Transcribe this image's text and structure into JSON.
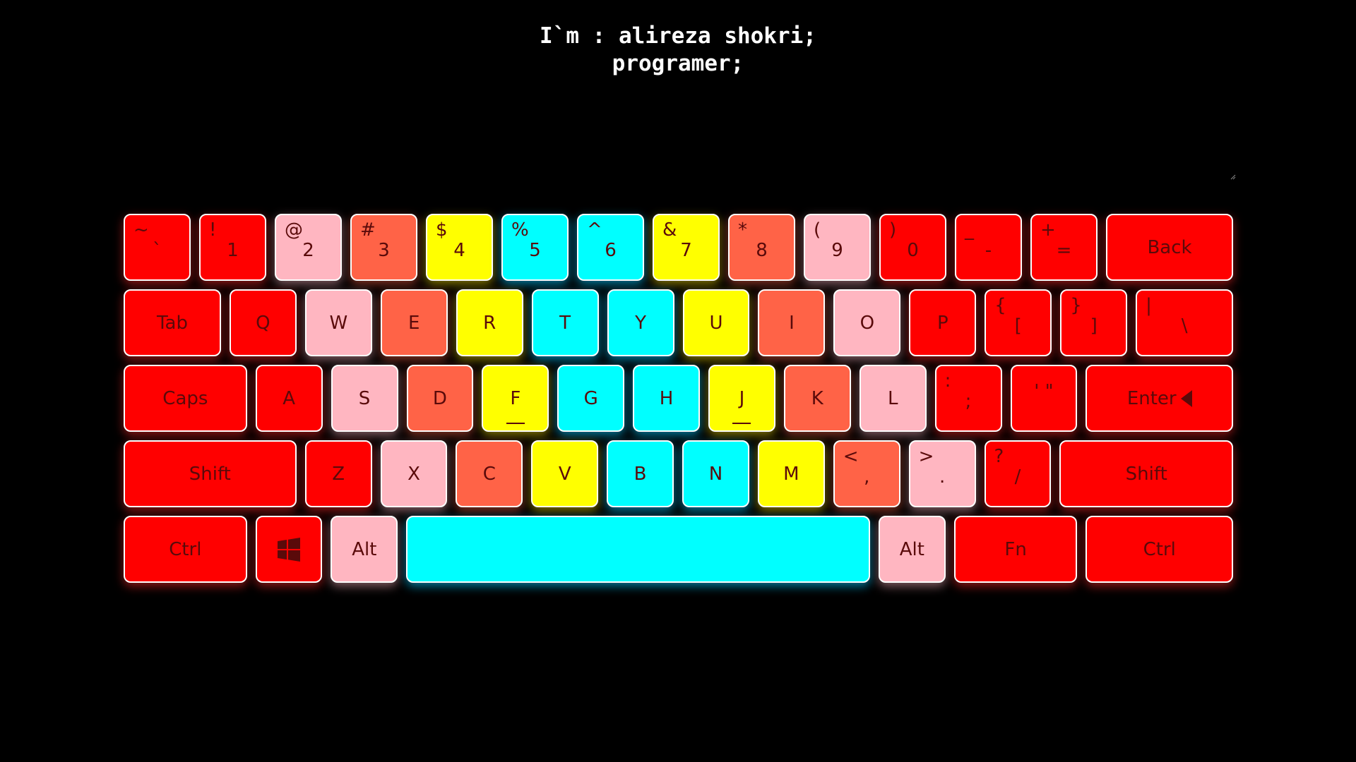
{
  "heading": {
    "line1": "I`m : alireza shokri;",
    "line2": "programer;"
  },
  "textarea": {
    "value": ""
  },
  "colors": {
    "background": "#000000",
    "red": "#ff0000",
    "pink": "#ffb6c1",
    "coral": "#ff6347",
    "yellow": "#ffff00",
    "cyan": "#00ffff"
  },
  "keyboard": {
    "row1": {
      "tilde": {
        "top": "~",
        "bottom": "`"
      },
      "k1": {
        "top": "!",
        "bottom": "1"
      },
      "k2": {
        "top": "@",
        "bottom": "2"
      },
      "k3": {
        "top": "#",
        "bottom": "3"
      },
      "k4": {
        "top": "$",
        "bottom": "4"
      },
      "k5": {
        "top": "%",
        "bottom": "5"
      },
      "k6": {
        "top": "^",
        "bottom": "6"
      },
      "k7": {
        "top": "&",
        "bottom": "7"
      },
      "k8": {
        "top": "*",
        "bottom": "8"
      },
      "k9": {
        "top": "(",
        "bottom": "9"
      },
      "k0": {
        "top": ")",
        "bottom": "0"
      },
      "minus": {
        "top": "_",
        "bottom": "-"
      },
      "equal": {
        "top": "+",
        "bottom": "="
      },
      "back": "Back"
    },
    "row2": {
      "tab": "Tab",
      "q": "Q",
      "w": "W",
      "e": "E",
      "r": "R",
      "t": "T",
      "y": "Y",
      "u": "U",
      "i": "I",
      "o": "O",
      "p": "P",
      "lbracket": {
        "top": "{",
        "bottom": "["
      },
      "rbracket": {
        "top": "}",
        "bottom": "]"
      },
      "backslash": {
        "top": "|",
        "bottom": "\\"
      }
    },
    "row3": {
      "caps": "Caps",
      "a": "A",
      "s": "S",
      "d": "D",
      "f": "F",
      "g": "G",
      "h": "H",
      "j": "J",
      "k": "K",
      "l": "L",
      "semicolon": {
        "top": ":",
        "bottom": ";"
      },
      "quote": "' \"",
      "enter": "Enter"
    },
    "row4": {
      "lshift": "Shift",
      "z": "Z",
      "x": "X",
      "c": "C",
      "v": "V",
      "b": "B",
      "n": "N",
      "m": "M",
      "comma": {
        "top": "<",
        "bottom": ","
      },
      "period": {
        "top": ">",
        "bottom": "."
      },
      "slash": {
        "top": "?",
        "bottom": "/"
      },
      "rshift": "Shift"
    },
    "row5": {
      "lctrl": "Ctrl",
      "win_icon": "windows-icon",
      "lalt": "Alt",
      "space": "",
      "ralt": "Alt",
      "fn": "Fn",
      "rctrl": "Ctrl"
    }
  }
}
